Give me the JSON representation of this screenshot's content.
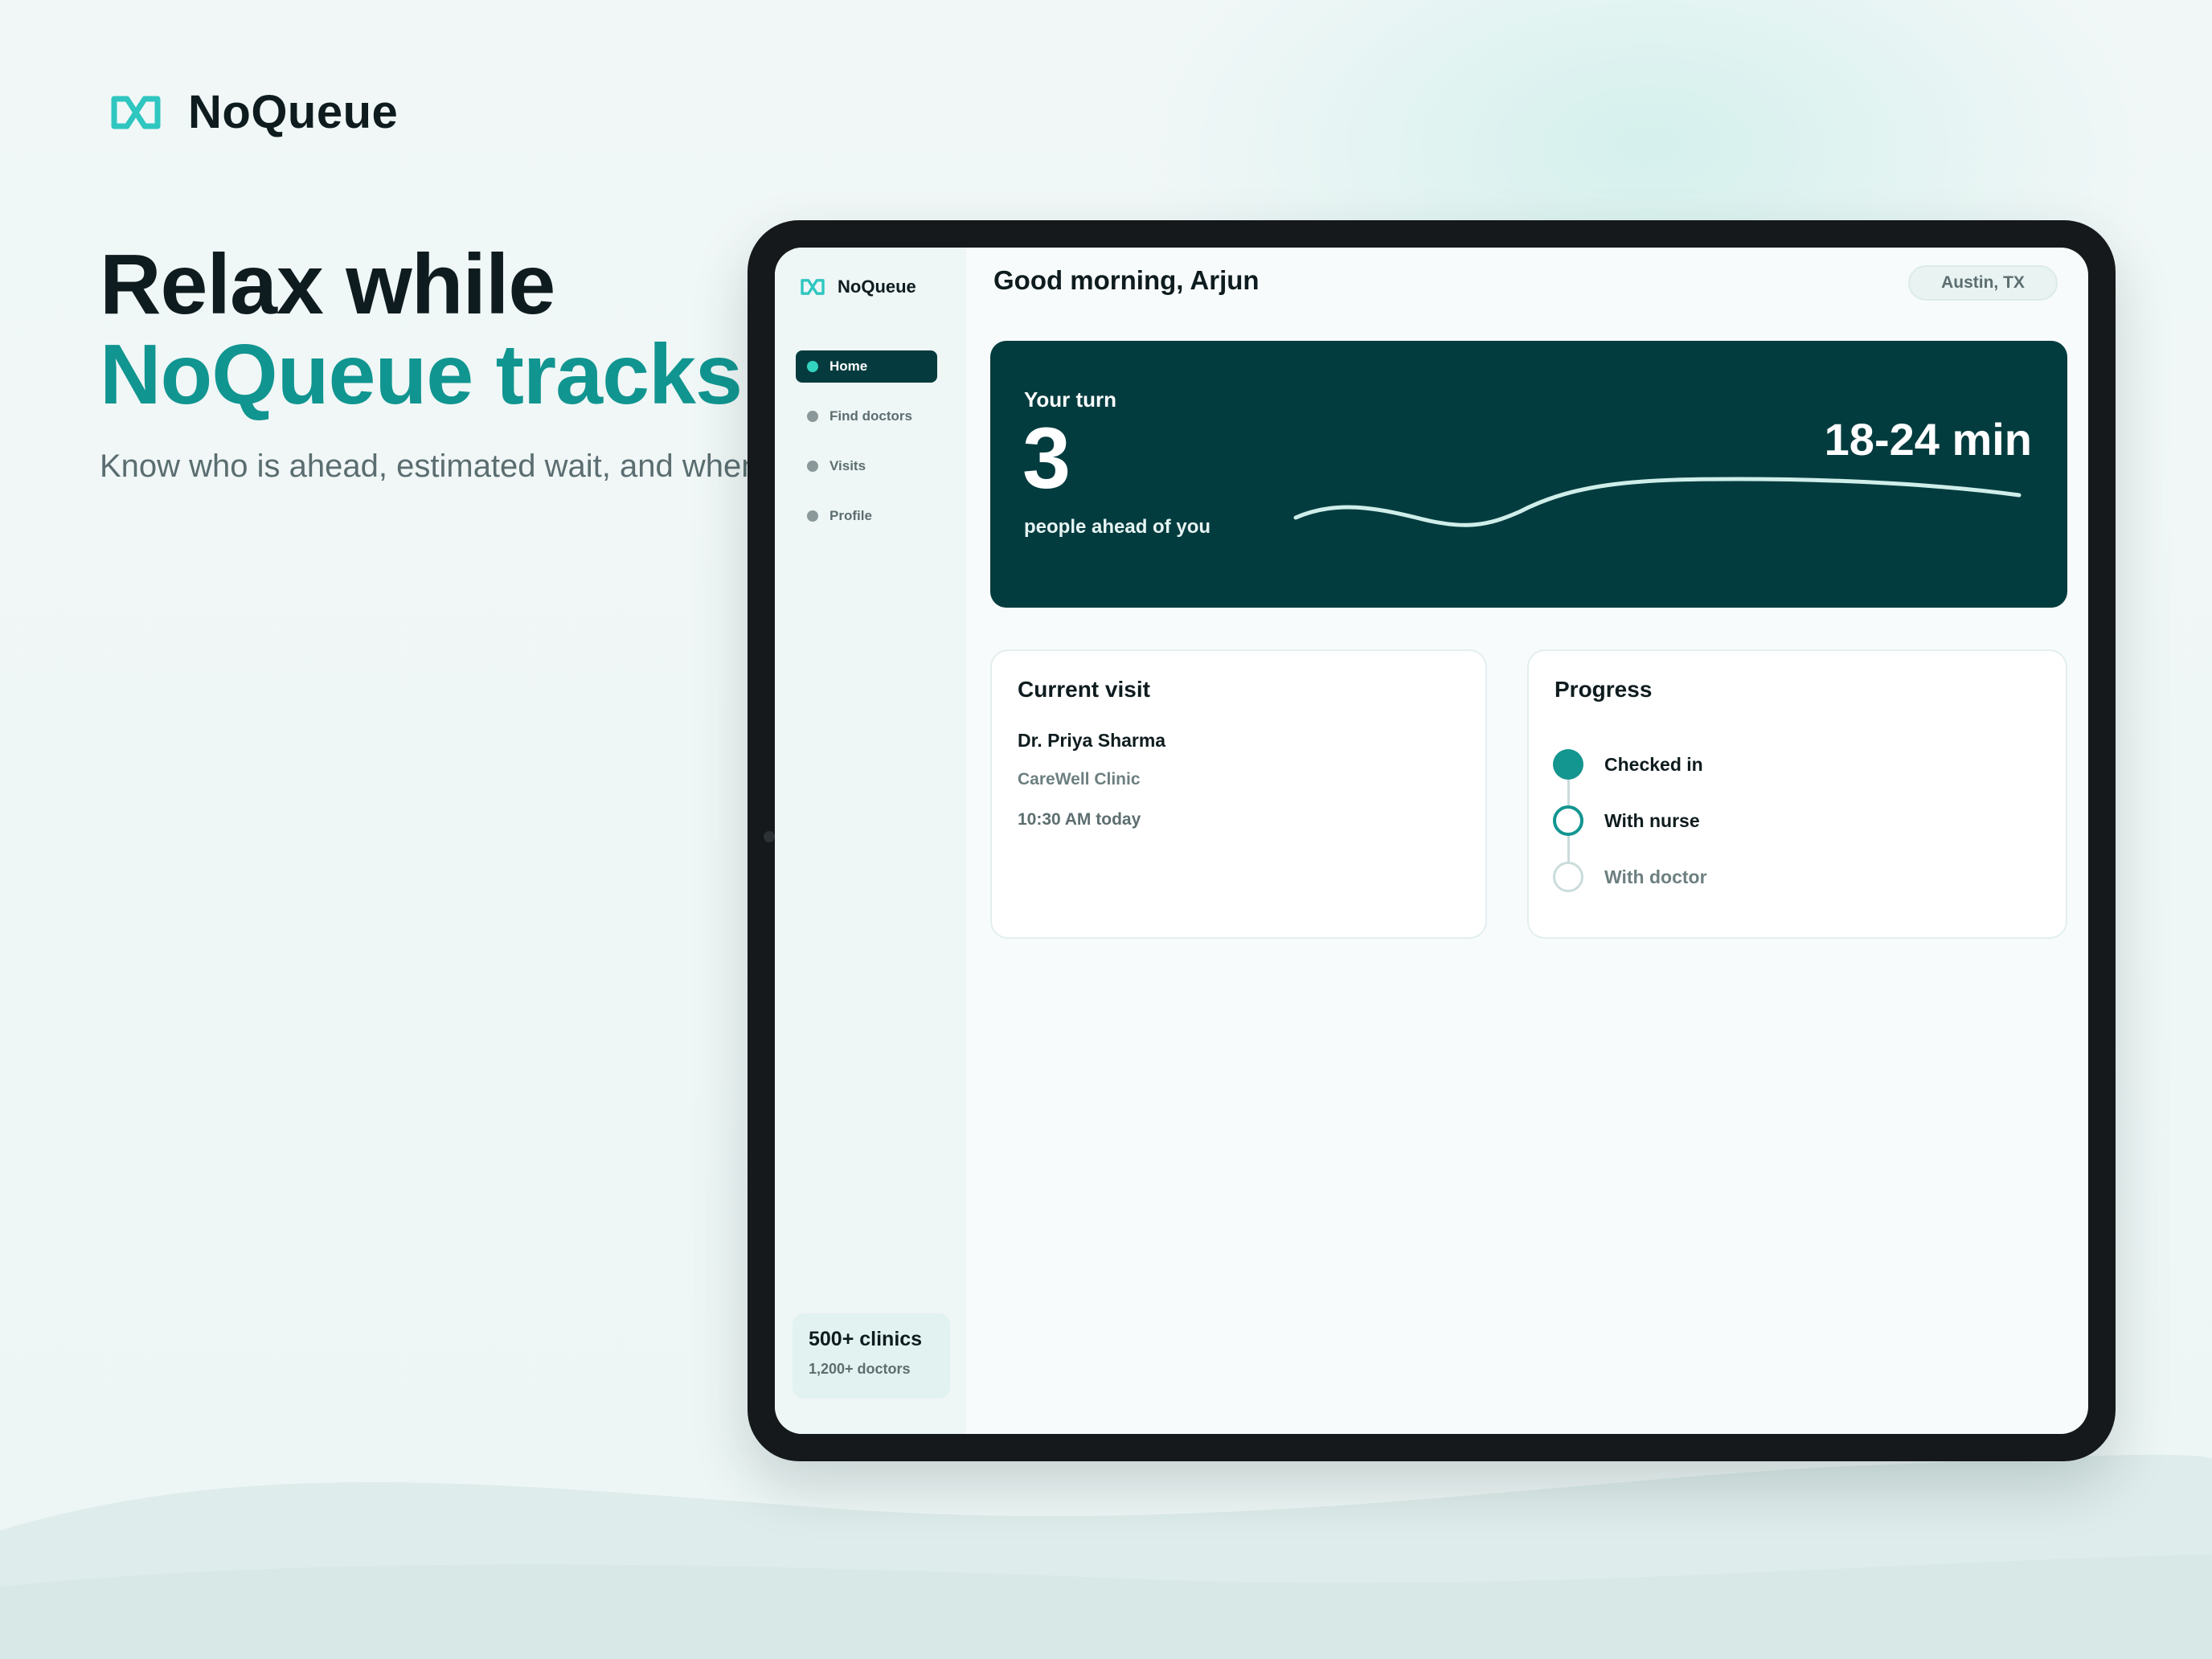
{
  "brand": {
    "name": "NoQueue",
    "accent": "#119590",
    "dark": "#033c3f"
  },
  "hero": {
    "line1": "Relax while",
    "line2": "NoQueue tracks.",
    "subtitle": "Know who is ahead, estimated wait, and when to leave."
  },
  "app": {
    "sidebar": {
      "brand": "NoQueue",
      "nav": [
        {
          "label": "Home",
          "active": true
        },
        {
          "label": "Find doctors",
          "active": false
        },
        {
          "label": "Visits",
          "active": false
        },
        {
          "label": "Profile",
          "active": false
        }
      ],
      "stats": {
        "clinics": "500+ clinics",
        "doctors": "1,200+ doctors"
      }
    },
    "header": {
      "greeting": "Good morning, Arjun",
      "location": "Austin, TX"
    },
    "turn": {
      "label": "Your turn",
      "count": "3",
      "sublabel": "people ahead of you",
      "wait": "18-24 min"
    },
    "current_visit": {
      "title": "Current visit",
      "doctor": "Dr. Priya Sharma",
      "clinic": "CareWell Clinic",
      "time": "10:30 AM today"
    },
    "progress": {
      "title": "Progress",
      "steps": [
        {
          "label": "Checked in",
          "state": "done"
        },
        {
          "label": "With nurse",
          "state": "current"
        },
        {
          "label": "With doctor",
          "state": "pending"
        }
      ]
    }
  },
  "icons": {
    "logo": "infinity-logo-icon",
    "nav_dot": "dot-icon"
  }
}
